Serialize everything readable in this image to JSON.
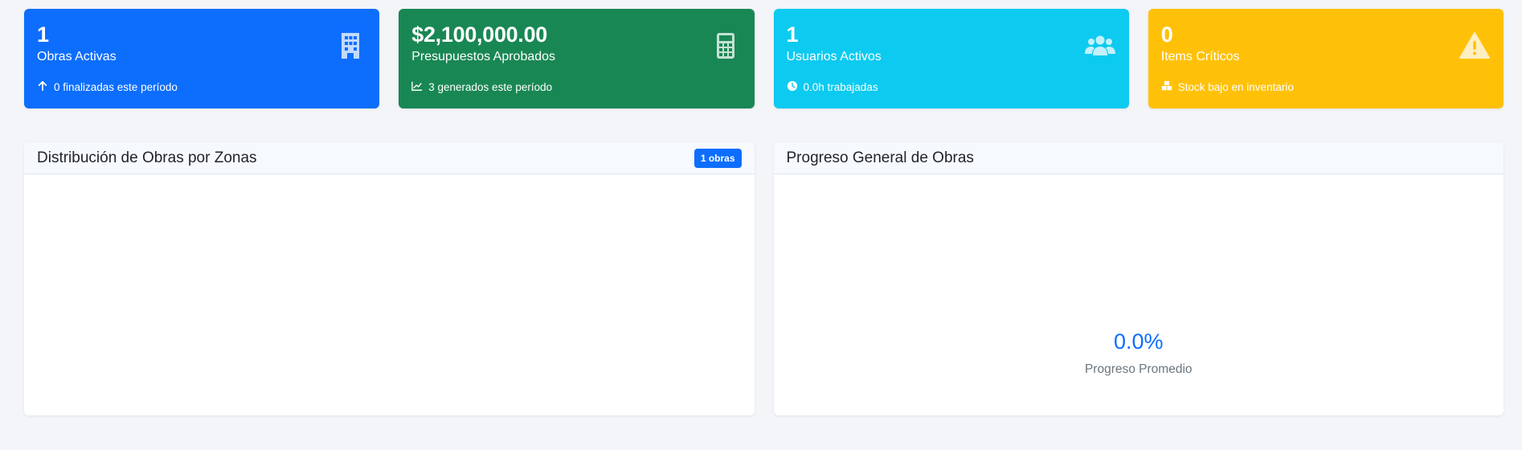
{
  "stats": [
    {
      "value": "1",
      "label": "Obras Activas",
      "footnote": "0 finalizadas este período",
      "icon": "building-icon",
      "foot_icon": "arrow-up-icon",
      "color": "#0d6efd"
    },
    {
      "value": "$2,100,000.00",
      "label": "Presupuestos Aprobados",
      "footnote": "3 generados este período",
      "icon": "calculator-icon",
      "foot_icon": "chart-line-icon",
      "color": "#198754"
    },
    {
      "value": "1",
      "label": "Usuarios Activos",
      "footnote": "0.0h trabajadas",
      "icon": "users-icon",
      "foot_icon": "clock-icon",
      "color": "#0dcaf0"
    },
    {
      "value": "0",
      "label": "Items Críticos",
      "footnote": "Stock bajo en inventario",
      "icon": "warning-icon",
      "foot_icon": "boxes-icon",
      "color": "#ffc107"
    }
  ],
  "zones_panel": {
    "title": "Distribución de Obras por Zonas",
    "badge": "1 obras"
  },
  "progress_panel": {
    "title": "Progreso General de Obras",
    "value": "0.0%",
    "label": "Progreso Promedio"
  }
}
